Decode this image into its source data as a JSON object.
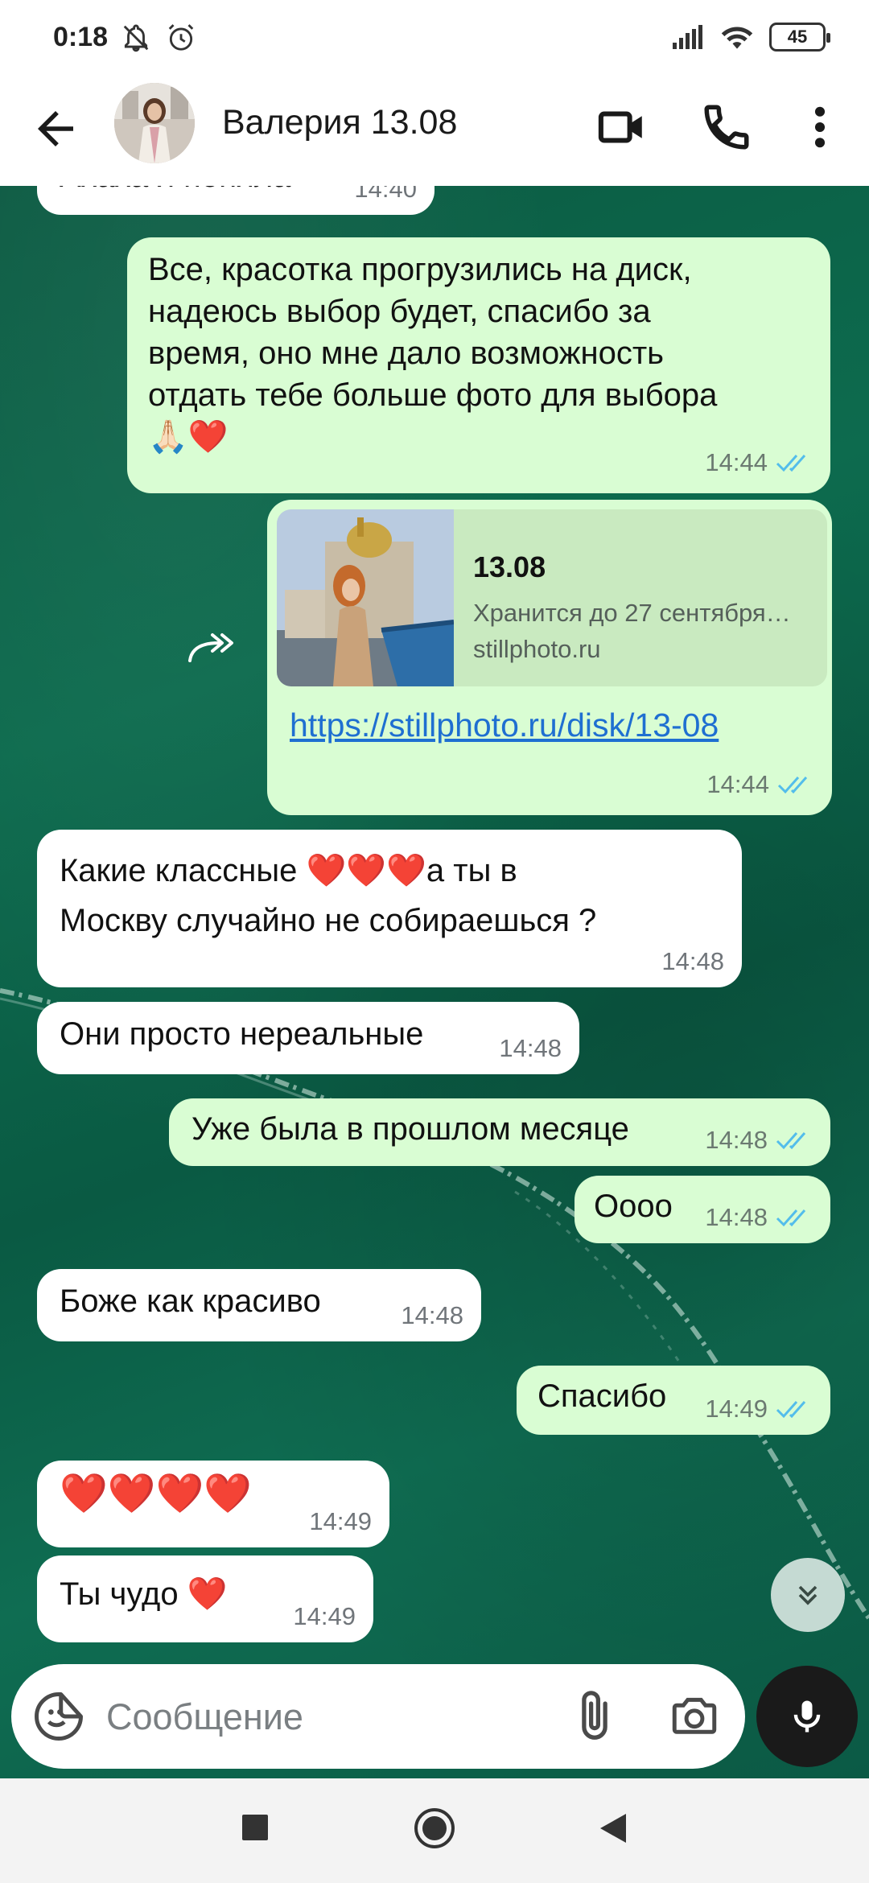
{
  "status_bar": {
    "time": "0:18",
    "battery": "45",
    "icons": [
      "notifications-off-icon",
      "alarm-icon",
      "signal-icon",
      "wifi-icon",
      "battery-icon"
    ]
  },
  "header": {
    "contact_name": "Валерия 13.08",
    "icons": [
      "back-arrow-icon",
      "video-call-icon",
      "phone-call-icon",
      "more-vert-icon"
    ]
  },
  "messages": [
    {
      "id": "m0",
      "direction": "in",
      "text_partial": "Ахаха я поняла",
      "time": "14:40"
    },
    {
      "id": "m1",
      "direction": "out",
      "lines": [
        "Все, красотка прогрузились на диск,",
        "надеюсь выбор будет, спасибо за",
        "время, оно мне дало возможность",
        "отдать тебе больше фото для выбора",
        "🙏🏻❤️"
      ],
      "time": "14:44",
      "read": true
    },
    {
      "id": "m2",
      "direction": "out",
      "forwarded": true,
      "link_preview": {
        "title": "13.08",
        "description": "Хранится до 27 сентября…",
        "domain": "stillphoto.ru"
      },
      "url": "https://stillphoto.ru/disk/13-08",
      "time": "14:44",
      "read": true
    },
    {
      "id": "m3",
      "direction": "in",
      "lines": [
        "Какие классные ❤️❤️❤️а ты в",
        "Москву случайно не собираешься ?"
      ],
      "time": "14:48"
    },
    {
      "id": "m4",
      "direction": "in",
      "lines": [
        "Они просто нереальные"
      ],
      "time": "14:48"
    },
    {
      "id": "m5",
      "direction": "out",
      "lines": [
        "Уже была в прошлом месяце"
      ],
      "time": "14:48",
      "read": true
    },
    {
      "id": "m6",
      "direction": "out",
      "lines": [
        "Оооо"
      ],
      "time": "14:48",
      "read": true
    },
    {
      "id": "m7",
      "direction": "in",
      "lines": [
        "Боже как красиво"
      ],
      "time": "14:48"
    },
    {
      "id": "m8",
      "direction": "out",
      "lines": [
        "Спасибо"
      ],
      "time": "14:49",
      "read": true
    },
    {
      "id": "m9",
      "direction": "in",
      "lines": [
        "❤️❤️❤️❤️"
      ],
      "time": "14:49"
    },
    {
      "id": "m10",
      "direction": "in",
      "lines": [
        "Ты чудо ❤️"
      ],
      "time": "14:49"
    }
  ],
  "composer": {
    "placeholder": "Сообщение",
    "value": ""
  },
  "colors": {
    "incoming_bubble": "#ffffff",
    "outgoing_bubble": "#d9fdd3",
    "read_ticks": "#53bdeb",
    "link": "#1f6fd1",
    "wallpaper": "#0b5a42"
  }
}
